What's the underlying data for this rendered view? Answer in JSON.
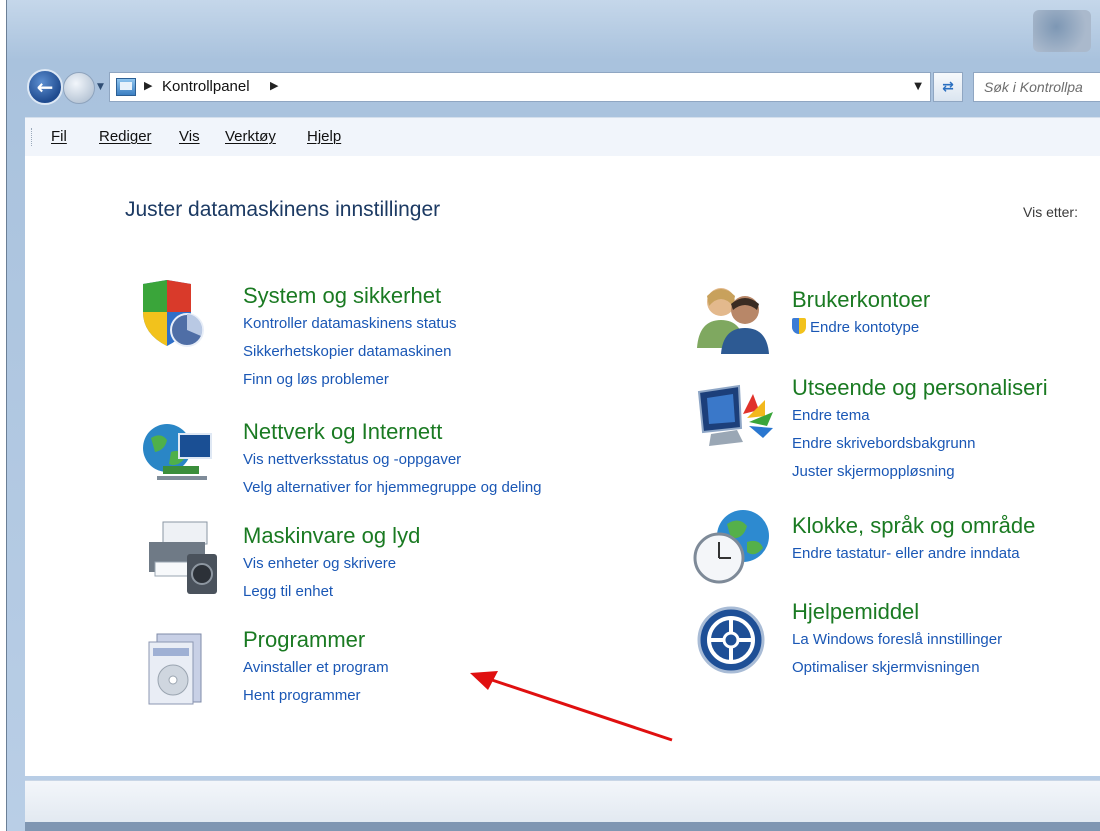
{
  "addressbar": {
    "crumb": "Kontrollpanel",
    "search_placeholder": "Søk i Kontrollpa"
  },
  "menu": {
    "file": "Fil",
    "edit": "Rediger",
    "view": "Vis",
    "tools": "Verktøy",
    "help": "Hjelp"
  },
  "page": {
    "title": "Juster datamaskinens innstillinger",
    "view_by": "Vis etter:"
  },
  "categories_left": [
    {
      "title": "System og sikkerhet",
      "links": [
        "Kontroller datamaskinens status",
        "Sikkerhetskopier datamaskinen",
        "Finn og løs problemer"
      ],
      "icon": "shield-pie-icon"
    },
    {
      "title": "Nettverk og Internett",
      "links": [
        "Vis nettverksstatus og -oppgaver",
        "Velg alternativer for hjemmegruppe og deling"
      ],
      "icon": "globe-network-icon"
    },
    {
      "title": "Maskinvare og lyd",
      "links": [
        "Vis enheter og skrivere",
        "Legg til enhet"
      ],
      "icon": "printer-speaker-icon"
    },
    {
      "title": "Programmer",
      "links": [
        "Avinstaller et program",
        "Hent programmer"
      ],
      "icon": "programs-box-icon"
    }
  ],
  "categories_right": [
    {
      "title": "Brukerkontoer",
      "links": [
        "Endre kontotype"
      ],
      "icon": "users-icon"
    },
    {
      "title": "Utseende og personaliseri",
      "links": [
        "Endre tema",
        "Endre skrivebordsbakgrunn",
        "Juster skjermoppløsning"
      ],
      "icon": "monitor-palette-icon"
    },
    {
      "title": "Klokke, språk og område",
      "links": [
        "Endre tastatur- eller andre inndata"
      ],
      "icon": "clock-globe-icon"
    },
    {
      "title": "Hjelpemiddel",
      "links": [
        "La Windows foreslå innstillinger",
        "Optimaliser skjermvisningen"
      ],
      "icon": "accessibility-icon"
    }
  ],
  "colors": {
    "category_title": "#1a7a22",
    "link": "#1a57b5",
    "annotation_arrow": "#e01010"
  }
}
